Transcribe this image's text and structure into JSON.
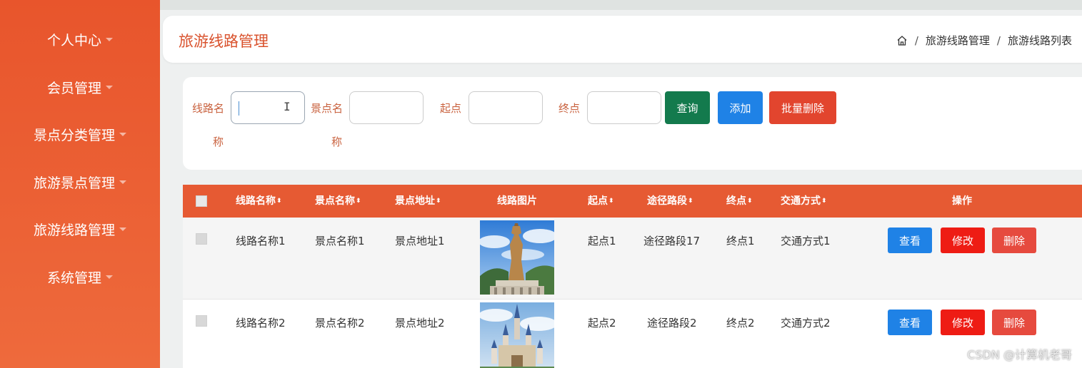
{
  "sidebar": {
    "items": [
      {
        "label": "个人中心"
      },
      {
        "label": "会员管理"
      },
      {
        "label": "景点分类管理"
      },
      {
        "label": "旅游景点管理"
      },
      {
        "label": "旅游线路管理"
      },
      {
        "label": "系统管理"
      }
    ]
  },
  "header": {
    "title": "旅游线路管理",
    "breadcrumb": [
      "旅游线路管理",
      "旅游线路列表"
    ]
  },
  "search": {
    "fields": [
      {
        "label_line1": "线路名",
        "label_line2": "称",
        "value": ""
      },
      {
        "label_line1": "景点名",
        "label_line2": "称",
        "value": ""
      },
      {
        "label_line1": "起点",
        "value": ""
      },
      {
        "label_line1": "终点",
        "value": ""
      }
    ],
    "query_label": "查询",
    "add_label": "添加",
    "batch_delete_label": "批量删除"
  },
  "table": {
    "columns": [
      "线路名称",
      "景点名称",
      "景点地址",
      "线路图片",
      "起点",
      "途径路段",
      "终点",
      "交通方式",
      "操作"
    ],
    "sort_glyph": "⬍",
    "rows": [
      {
        "route_name": "线路名称1",
        "spot_name": "景点名称1",
        "spot_address": "景点地址1",
        "start": "起点1",
        "via": "途径路段17",
        "end": "终点1",
        "transport": "交通方式1"
      },
      {
        "route_name": "线路名称2",
        "spot_name": "景点名称2",
        "spot_address": "景点地址2",
        "start": "起点2",
        "via": "途径路段2",
        "end": "终点2",
        "transport": "交通方式2"
      }
    ],
    "actions": {
      "view": "查看",
      "edit": "修改",
      "delete": "删除"
    }
  },
  "watermark": "CSDN @计算机老哥",
  "colors": {
    "sidebar": "#e8552c",
    "table_header": "#e65a33",
    "query": "#137a4d",
    "add": "#1f82e6",
    "batch_delete": "#e2452e",
    "edit": "#ee1c14"
  }
}
